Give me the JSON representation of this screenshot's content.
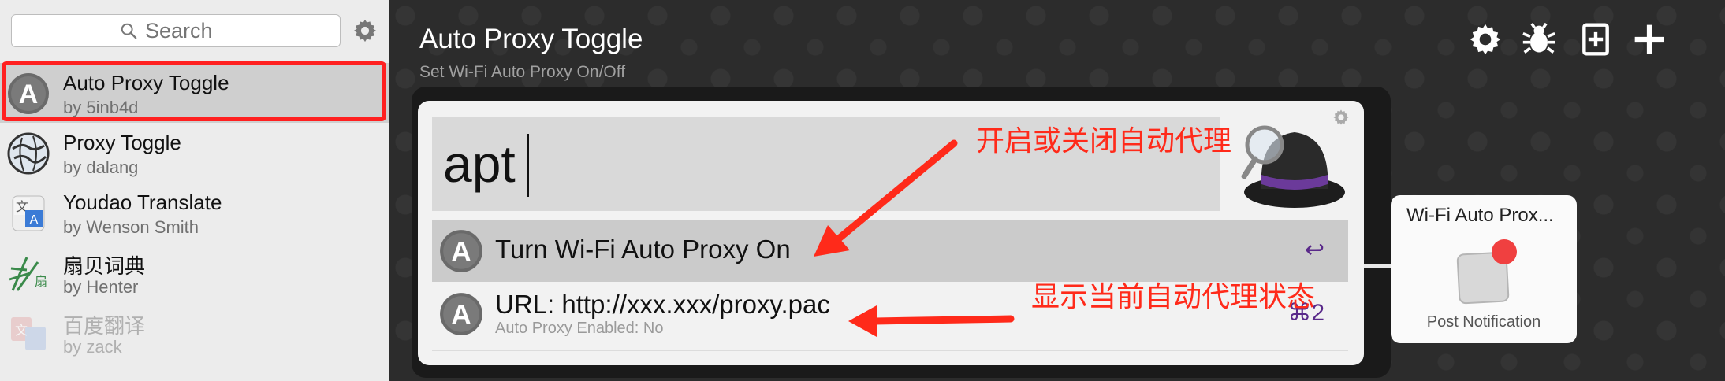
{
  "sidebar": {
    "search_placeholder": "Search",
    "workflows": [
      {
        "name": "Auto Proxy Toggle",
        "author": "by 5inb4d",
        "selected": true
      },
      {
        "name": "Proxy Toggle",
        "author": "by dalang"
      },
      {
        "name": "Youdao Translate",
        "author": "by Wenson Smith"
      },
      {
        "name": "扇贝词典",
        "author": "by Henter",
        "icon_glyph": "扇"
      },
      {
        "name": "百度翻译",
        "author": "by zack",
        "disabled": true
      }
    ]
  },
  "workflow": {
    "title": "Auto Proxy Toggle",
    "subtitle": "Set Wi-Fi Auto Proxy On/Off"
  },
  "toolbar": {
    "icons": [
      "gear-icon",
      "bug-icon",
      "add-note-icon",
      "plus-icon"
    ]
  },
  "alfred": {
    "query": "apt",
    "results": [
      {
        "title": "Turn Wi-Fi Auto Proxy On",
        "subtitle": "",
        "shortcut": "↩",
        "selected": true
      },
      {
        "title": "URL: http://xxx.xxx/proxy.pac",
        "subtitle": "Auto Proxy Enabled: No",
        "shortcut": "⌘2"
      }
    ]
  },
  "node": {
    "title": "Wi-Fi Auto Prox...",
    "label": "Post Notification"
  },
  "annotations": {
    "toggle": "开启或关闭自动代理",
    "status": "显示当前自动代理状态"
  },
  "colors": {
    "annotation_red": "#ff2a1a",
    "shortcut_purple": "#5a2a8a",
    "selected_outline": "#ff2020"
  }
}
